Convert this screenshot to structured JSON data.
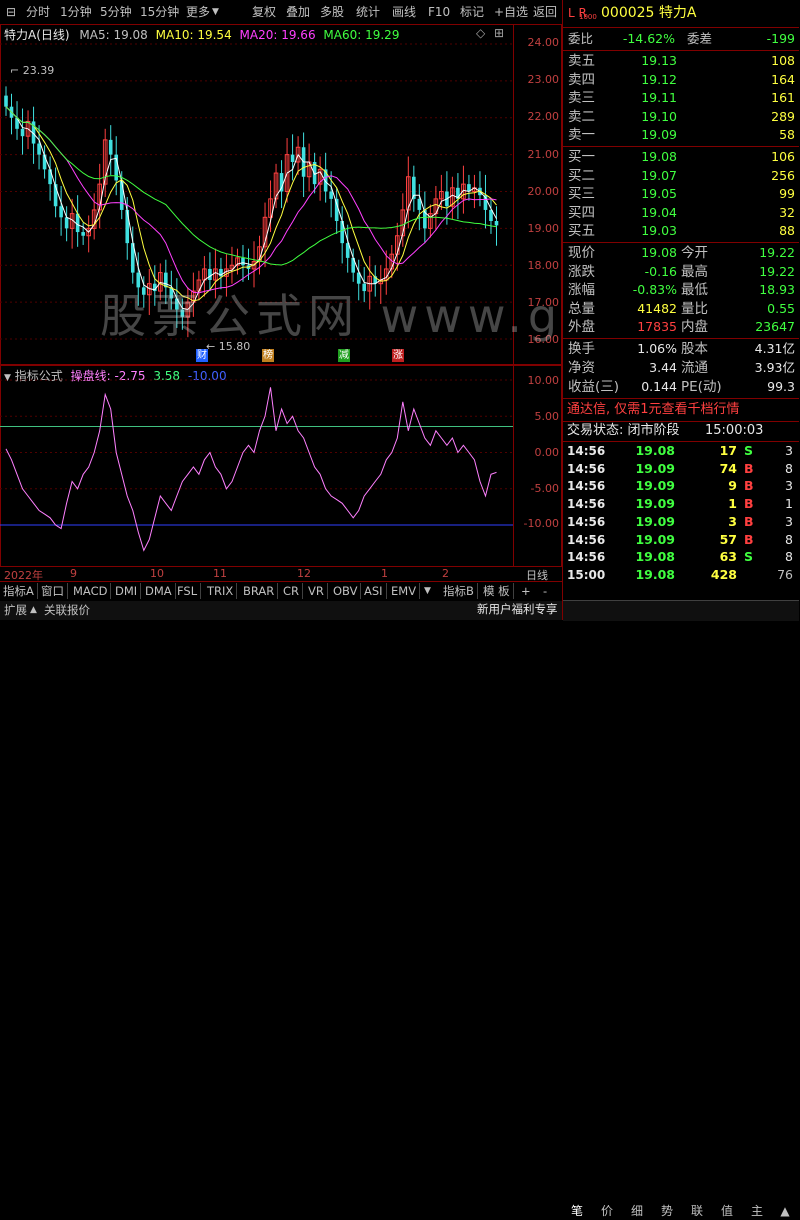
{
  "toolbar": {
    "left": [
      "分时",
      "1分钟",
      "5分钟",
      "15分钟",
      "更多"
    ],
    "right": [
      "复权",
      "叠加",
      "多股",
      "统计",
      "画线",
      "F10",
      "标记",
      "+自选",
      "返回"
    ]
  },
  "chart": {
    "title": "特力A(日线)",
    "ma": [
      {
        "label": "MA5: 19.08",
        "color": "#ffffff"
      },
      {
        "label": "MA10: 19.54",
        "color": "#ffff40"
      },
      {
        "label": "MA20: 19.66",
        "color": "#ff40ff"
      },
      {
        "label": "MA60: 19.29",
        "color": "#40ff40"
      }
    ],
    "y_labels": [
      "24.00",
      "23.00",
      "22.00",
      "21.00",
      "20.00",
      "19.00",
      "18.00",
      "17.00",
      "16.00"
    ],
    "high_mark": "23.39",
    "low_mark": "15.80",
    "markers": [
      {
        "text": "财",
        "color": "#2060ff"
      },
      {
        "text": "榜",
        "color": "#c08020"
      },
      {
        "text": "减",
        "color": "#20a020"
      },
      {
        "text": "涨",
        "color": "#c02020"
      }
    ],
    "watermark": "股票公式网 www.gpxs.com"
  },
  "indicator": {
    "name": "指标公式",
    "line_label": "操盘线: -2.75",
    "v2": "3.58",
    "v3": "-10.00",
    "y_labels": [
      "10.00",
      "5.00",
      "0.00",
      "-5.00",
      "-10.00"
    ]
  },
  "date_axis": {
    "labels": [
      "2022年",
      "9",
      "10",
      "11",
      "12",
      "1",
      "2"
    ],
    "right": "日线"
  },
  "tabs": [
    "指标A",
    "窗口",
    "MACD",
    "DMI",
    "DMA",
    "FSL",
    "TRIX",
    "BRAR",
    "CR",
    "VR",
    "OBV",
    "ASI",
    "EMV"
  ],
  "tabs_right": [
    "指标B",
    "模 板"
  ],
  "tab_plus": "+",
  "tab_minus": "-",
  "bottom_left": [
    "扩展",
    "关联报价"
  ],
  "quote": {
    "lr": "L R",
    "lr_sub": "1000",
    "code_name": "000025 特力A",
    "weibi_label": "委比",
    "weibi": "-14.62%",
    "weicha_label": "委差",
    "weicha": "-199",
    "sell": [
      {
        "label": "卖五",
        "price": "19.13",
        "vol": "108"
      },
      {
        "label": "卖四",
        "price": "19.12",
        "vol": "164"
      },
      {
        "label": "卖三",
        "price": "19.11",
        "vol": "161"
      },
      {
        "label": "卖二",
        "price": "19.10",
        "vol": "289"
      },
      {
        "label": "卖一",
        "price": "19.09",
        "vol": "58"
      }
    ],
    "buy": [
      {
        "label": "买一",
        "price": "19.08",
        "vol": "106"
      },
      {
        "label": "买二",
        "price": "19.07",
        "vol": "256"
      },
      {
        "label": "买三",
        "price": "19.05",
        "vol": "99"
      },
      {
        "label": "买四",
        "price": "19.04",
        "vol": "32"
      },
      {
        "label": "买五",
        "price": "19.03",
        "vol": "88"
      }
    ],
    "stats": [
      {
        "l1": "现价",
        "v1": "19.08",
        "c1": "#40ff40",
        "l2": "今开",
        "v2": "19.22",
        "c2": "#40ff40"
      },
      {
        "l1": "涨跌",
        "v1": "-0.16",
        "c1": "#40ff40",
        "l2": "最高",
        "v2": "19.22",
        "c2": "#40ff40"
      },
      {
        "l1": "涨幅",
        "v1": "-0.83%",
        "c1": "#40ff40",
        "l2": "最低",
        "v2": "18.93",
        "c2": "#40ff40"
      },
      {
        "l1": "总量",
        "v1": "41482",
        "c1": "#ffff40",
        "l2": "量比",
        "v2": "0.55",
        "c2": "#40ff40"
      },
      {
        "l1": "外盘",
        "v1": "17835",
        "c1": "#ff4040",
        "l2": "内盘",
        "v2": "23647",
        "c2": "#40ff40"
      }
    ],
    "stats2": [
      {
        "l1": "换手",
        "v1": "1.06%",
        "l2": "股本",
        "v2": "4.31亿"
      },
      {
        "l1": "净资",
        "v1": "3.44",
        "l2": "流通",
        "v2": "3.93亿"
      },
      {
        "l1": "收益(三)",
        "v1": "0.144",
        "l2": "PE(动)",
        "v2": "99.3"
      }
    ],
    "promo": "通达信, 仅需1元查看千档行情",
    "status_label": "交易状态: 闭市阶段",
    "status_time": "15:00:03",
    "ticks": [
      {
        "t": "14:56",
        "p": "19.08",
        "v": "17",
        "s": "S",
        "n": "3"
      },
      {
        "t": "14:56",
        "p": "19.09",
        "v": "74",
        "s": "B",
        "n": "8"
      },
      {
        "t": "14:56",
        "p": "19.09",
        "v": "9",
        "s": "B",
        "n": "3"
      },
      {
        "t": "14:56",
        "p": "19.09",
        "v": "1",
        "s": "B",
        "n": "1"
      },
      {
        "t": "14:56",
        "p": "19.09",
        "v": "3",
        "s": "B",
        "n": "3"
      },
      {
        "t": "14:56",
        "p": "19.09",
        "v": "57",
        "s": "B",
        "n": "8"
      },
      {
        "t": "14:56",
        "p": "19.08",
        "v": "63",
        "s": "S",
        "n": "8"
      },
      {
        "t": "15:00",
        "p": "19.08",
        "v": "428",
        "s": "",
        "n": "76"
      }
    ],
    "new_user": "新用户福利专享",
    "right_tabs": [
      "笔",
      "价",
      "细",
      "势",
      "联",
      "值",
      "主"
    ]
  }
}
